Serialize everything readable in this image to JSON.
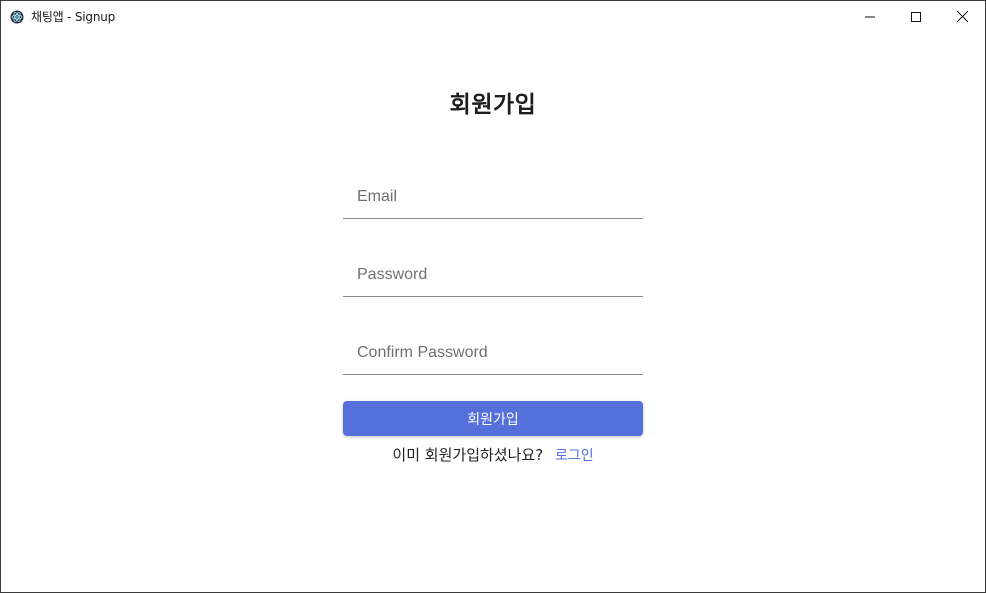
{
  "window": {
    "title": "채팅앱 - Signup",
    "icon": "electron-atom-icon",
    "controls": [
      "minimize-icon",
      "maximize-icon",
      "close-icon"
    ]
  },
  "signup": {
    "title": "회원가입",
    "email": {
      "placeholder": "Email",
      "value": ""
    },
    "password": {
      "placeholder": "Password",
      "value": ""
    },
    "confirm_password": {
      "placeholder": "Confirm Password",
      "value": ""
    },
    "submit_label": "회원가입",
    "login_prompt": "이미 회원가입하셨나요?",
    "login_link": "로그인"
  },
  "colors": {
    "accent": "#5670db",
    "text": "#202020",
    "placeholder": "#707070",
    "underline": "#8a8a8a",
    "background": "#ffffff"
  }
}
